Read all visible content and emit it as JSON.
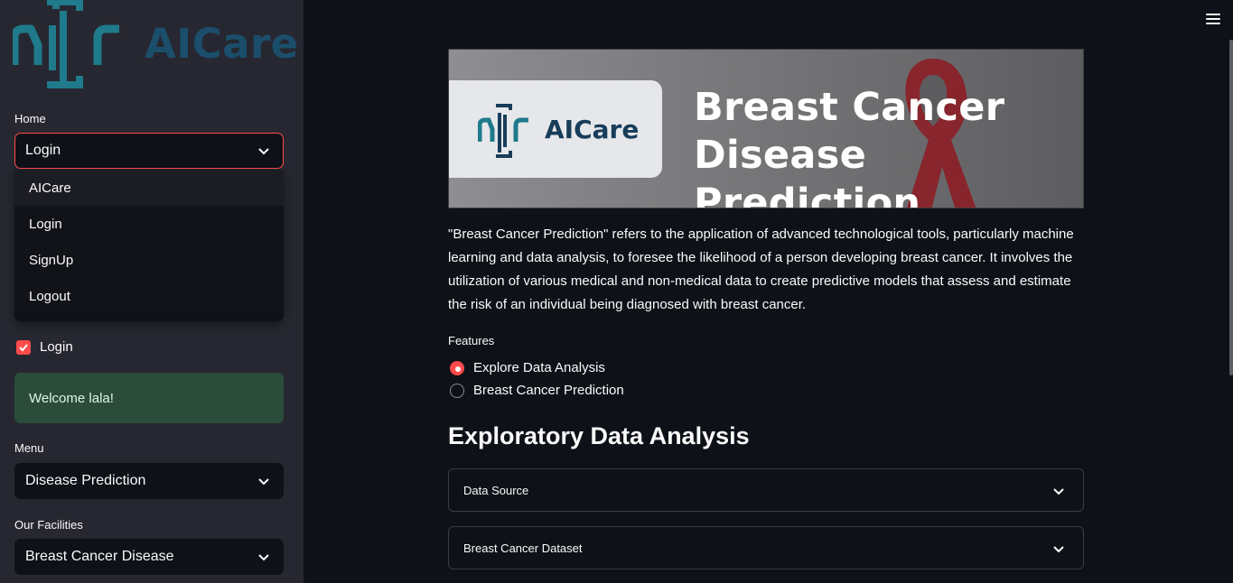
{
  "sidebar": {
    "logo_text": "AICare",
    "home_label": "Home",
    "home_select": {
      "value": "Login",
      "options": [
        "AICare",
        "Login",
        "SignUp",
        "Logout"
      ]
    },
    "login_checkbox": {
      "label": "Login",
      "checked": true
    },
    "welcome_message": "Welcome lala!",
    "menu_label": "Menu",
    "menu_select": {
      "value": "Disease Prediction"
    },
    "facilities_label": "Our Facilities",
    "facilities_select": {
      "value": "Breast Cancer Disease"
    }
  },
  "main": {
    "banner": {
      "brand": "AICare",
      "title_line1": "Breast Cancer",
      "title_line2": "Disease Prediction"
    },
    "description": "\"Breast Cancer Prediction\" refers to the application of advanced technological tools, particularly machine learning and data analysis, to foresee the likelihood of a person developing breast cancer. It involves the utilization of various medical and non-medical data to create predictive models that assess and estimate the risk of an individual being diagnosed with breast cancer.",
    "features": {
      "label": "Features",
      "options": [
        "Explore Data Analysis",
        "Breast Cancer Prediction"
      ],
      "selected": "Explore Data Analysis"
    },
    "section_title": "Exploratory Data Analysis",
    "expanders": [
      "Data Source",
      "Breast Cancer Dataset"
    ]
  },
  "colors": {
    "accent": "#ff4b4b",
    "sidebar_bg": "#262730",
    "main_bg": "#0e1117",
    "brand_teal": "#1f7a8c",
    "brand_navy": "#1b4e6b",
    "success_bg": "#2b4c3a"
  },
  "icons": {
    "menu": "hamburger-icon",
    "select_chevron": "chevron-down-icon",
    "checkbox": "check-icon"
  }
}
